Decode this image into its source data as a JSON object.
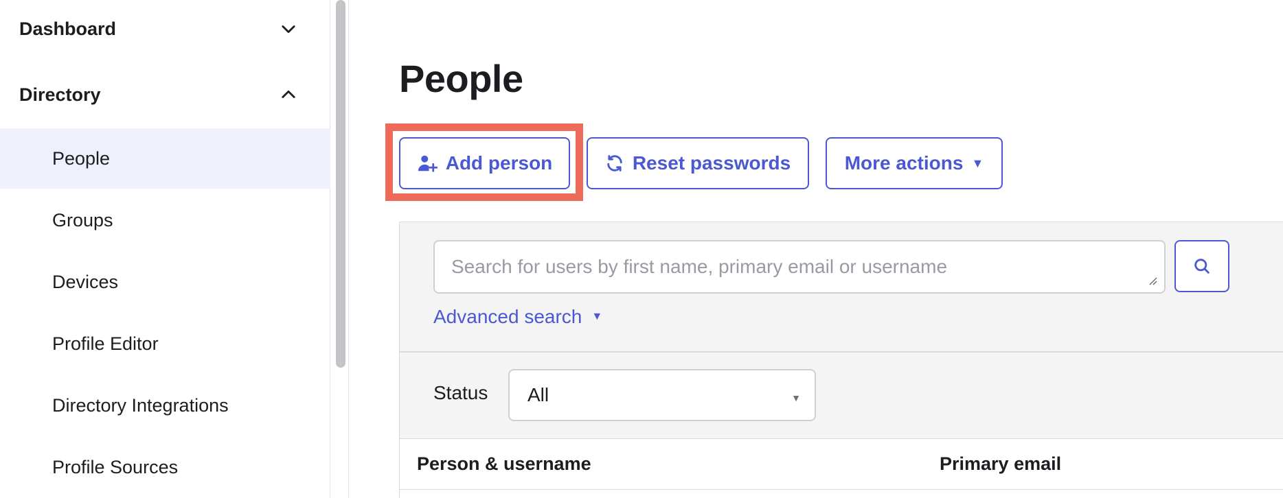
{
  "sidebar": {
    "sections": [
      {
        "label": "Dashboard",
        "expanded": false
      },
      {
        "label": "Directory",
        "expanded": true
      }
    ],
    "items": [
      {
        "label": "People",
        "active": true
      },
      {
        "label": "Groups"
      },
      {
        "label": "Devices"
      },
      {
        "label": "Profile Editor"
      },
      {
        "label": "Directory Integrations"
      },
      {
        "label": "Profile Sources"
      }
    ]
  },
  "main": {
    "title": "People",
    "actions": {
      "add_person": "Add person",
      "reset_passwords": "Reset passwords",
      "more_actions": "More actions"
    },
    "search": {
      "placeholder": "Search for users by first name, primary email or username",
      "advanced_label": "Advanced search"
    },
    "filter": {
      "status_label": "Status",
      "status_value": "All"
    },
    "table": {
      "columns": [
        "Person & username",
        "Primary email"
      ]
    }
  },
  "colors": {
    "accent": "#4a58d4",
    "highlight": "#ec6a57",
    "active_nav_bg": "#eef0fb"
  }
}
